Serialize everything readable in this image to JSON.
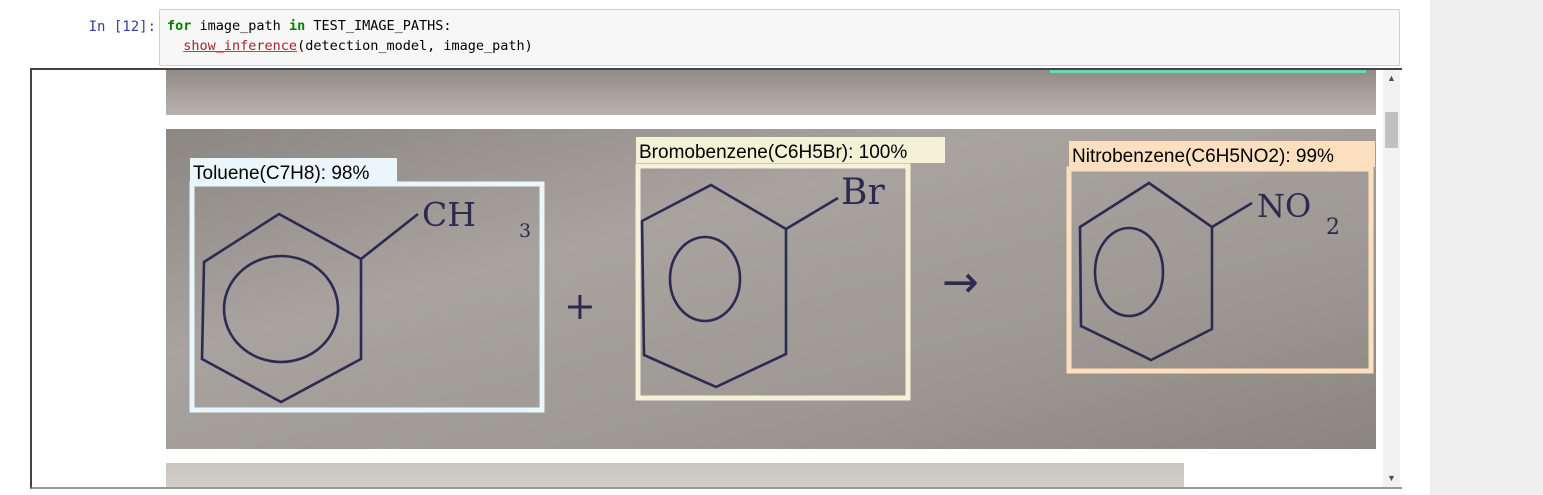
{
  "cell": {
    "prompt": "In [12]:",
    "code": {
      "line1": {
        "kw_for": "for",
        "var": " image_path ",
        "kw_in": "in",
        "rest": " TEST_IMAGE_PATHS:"
      },
      "line2": {
        "indent": "  ",
        "fn": "show_inference",
        "rest": "(detection_model, image_path)"
      }
    }
  },
  "output": {
    "detections": [
      {
        "label": "Toluene(C7H8): 98%",
        "box_color": "#eaf6fb"
      },
      {
        "label": "Bromobenzene(C6H5Br): 100%",
        "box_color": "#f3f1d6"
      },
      {
        "label": "Nitrobenzene(C6H5NO2): 99%",
        "box_color": "#fbdfbf"
      }
    ],
    "handwriting": {
      "ch3": "CH",
      "ch3_sub": "3",
      "br": "Br",
      "no2": "NO",
      "no2_sub": "2",
      "plus": "+",
      "arrow": "→"
    }
  },
  "scrollbar": {
    "up_icon": "▲",
    "down_icon": "▼"
  }
}
